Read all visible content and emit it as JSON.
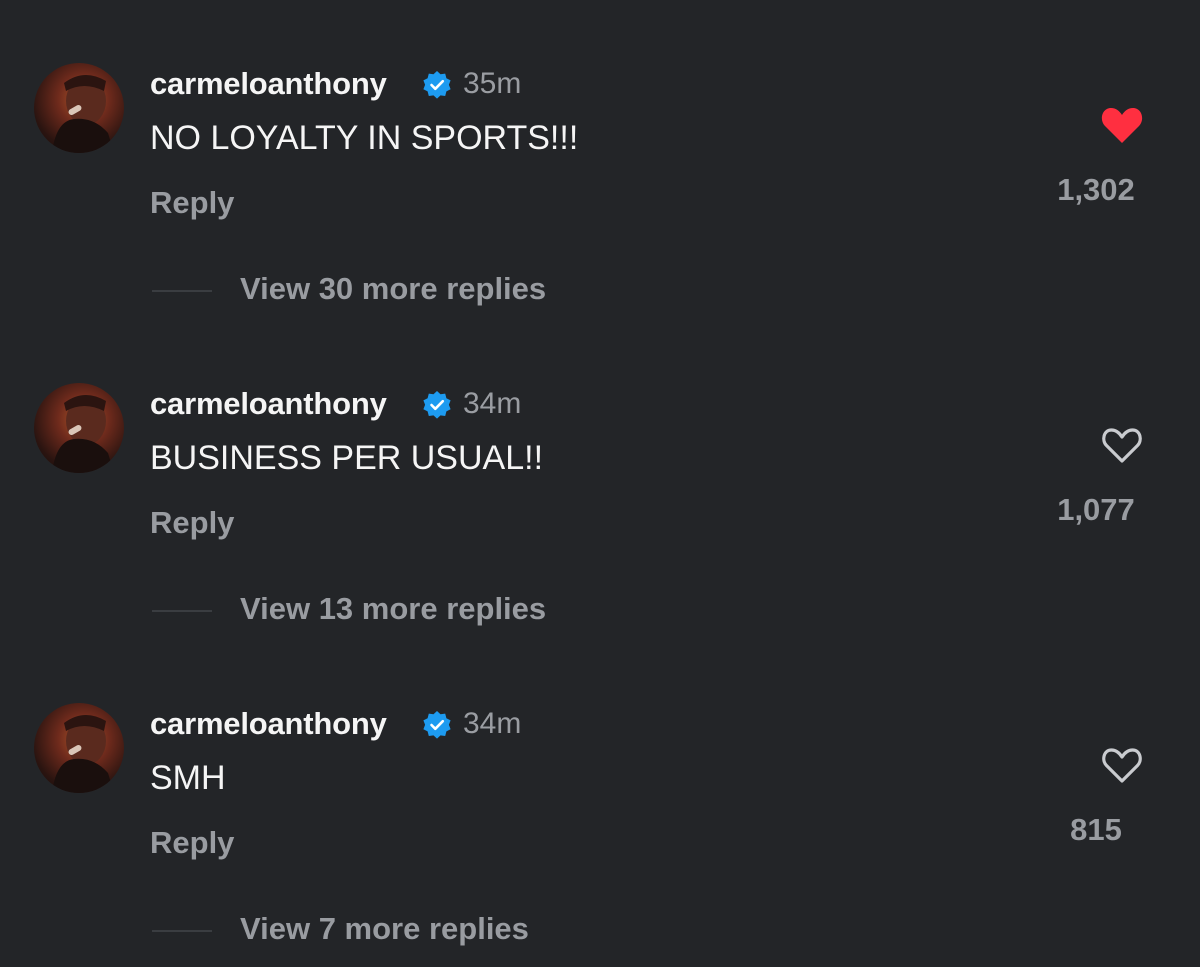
{
  "colors": {
    "background": "#232528",
    "primary_text": "#f5f5f5",
    "secondary_text": "#999ca1",
    "verified_blue": "#1d9bf0",
    "liked_red": "#ff2f40"
  },
  "comments": [
    {
      "username": "carmeloanthony",
      "verified_icon": "verified-badge-icon",
      "time": "35m",
      "text": "NO LOYALTY IN SPORTS!!!",
      "reply_label": "Reply",
      "view_replies_label": "View 30 more replies",
      "liked": true,
      "heart_icon": "heart-filled-icon",
      "likes": "1,302"
    },
    {
      "username": "carmeloanthony",
      "verified_icon": "verified-badge-icon",
      "time": "34m",
      "text": "BUSINESS PER USUAL!!",
      "reply_label": "Reply",
      "view_replies_label": "View 13 more replies",
      "liked": false,
      "heart_icon": "heart-outline-icon",
      "likes": "1,077"
    },
    {
      "username": "carmeloanthony",
      "verified_icon": "verified-badge-icon",
      "time": "34m",
      "text": "SMH",
      "reply_label": "Reply",
      "view_replies_label": "View 7 more replies",
      "liked": false,
      "heart_icon": "heart-outline-icon",
      "likes": "815"
    }
  ]
}
